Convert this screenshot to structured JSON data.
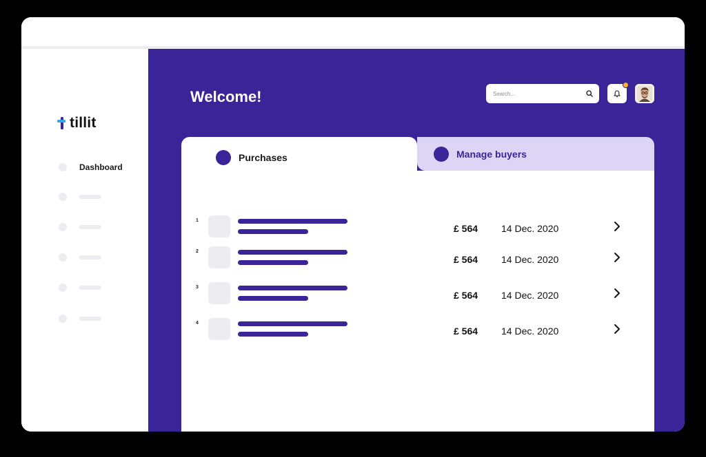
{
  "brand": {
    "name": "tillit",
    "logo_mark_color": "#3b2497",
    "logo_mark_accent": "#2fa7e8"
  },
  "sidebar": {
    "items": [
      {
        "label": "Dashboard",
        "active": true
      },
      {
        "label": ""
      },
      {
        "label": ""
      },
      {
        "label": ""
      },
      {
        "label": ""
      }
    ]
  },
  "header": {
    "title": "Welcome!",
    "search_placeholder": "Search...",
    "notifications_badge": true
  },
  "tabs": [
    {
      "label": "Purchases",
      "active": true
    },
    {
      "label": "Manage buyers",
      "active": false
    }
  ],
  "purchases": [
    {
      "index": "1",
      "amount": "£ 564",
      "date": "14 Dec. 2020"
    },
    {
      "index": "2",
      "amount": "£ 564",
      "date": "14 Dec. 2020"
    },
    {
      "index": "3",
      "amount": "£ 564",
      "date": "14 Dec. 2020"
    },
    {
      "index": "4",
      "amount": "£ 564",
      "date": "14 Dec. 2020"
    }
  ],
  "colors": {
    "primary": "#3b2497",
    "tab_inactive": "#ddd5f6",
    "placeholder_gray": "#ececf1",
    "badge": "#f5b23c"
  },
  "icons": [
    "search-icon",
    "bell-icon",
    "chevron-right-icon",
    "avatar"
  ]
}
